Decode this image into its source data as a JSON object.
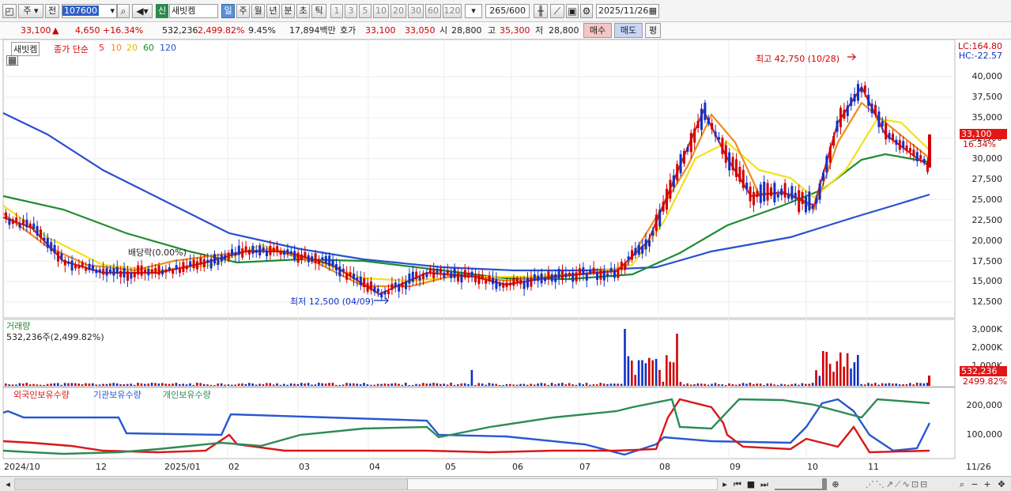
{
  "toolbar": {
    "period_unit": "주",
    "prev_label": "전",
    "code": "107600",
    "market_badge": "신",
    "stock_name": "새빗켐",
    "periods": [
      "일",
      "주",
      "월",
      "년",
      "분",
      "초",
      "틱"
    ],
    "selected_period": "일",
    "minutes": [
      "1",
      "3",
      "5",
      "10",
      "20",
      "30",
      "60",
      "120"
    ],
    "count_value": "265",
    "count_total": "/600",
    "date": "2025/11/26"
  },
  "quote": {
    "price": "33,100",
    "arrow": "▲",
    "change": "4,650",
    "change_pct": "+16.34%",
    "volume": "532,236",
    "volume_pct": "2,499.82%",
    "turnover": "9.45%",
    "amount": "17,894백만",
    "bid_label": "호가",
    "ask": "33,100",
    "bid": "33,050",
    "open_label": "시",
    "open": "28,800",
    "high_label": "고",
    "high": "35,300",
    "low_label": "저",
    "low": "28,800",
    "buy_label": "매수",
    "sell_label": "매도",
    "eval_label": "평"
  },
  "legend": {
    "name": "새빗켐",
    "close_label": "종가 단순",
    "ma": [
      {
        "label": "5",
        "color": "#e02020"
      },
      {
        "label": "10",
        "color": "#f08c1e"
      },
      {
        "label": "20",
        "color": "#f2e21e"
      },
      {
        "label": "60",
        "color": "#1e8c32"
      },
      {
        "label": "120",
        "color": "#2850d2"
      }
    ]
  },
  "annotations": {
    "high": "최고 42,750 (10/28)",
    "low": "최저 12,500 (04/09)",
    "dividend": "배당락(0.00%)"
  },
  "price_axis": {
    "lc": "LC:164.80",
    "hc": "HC:-22.57",
    "ticks": [
      "40,000",
      "37,500",
      "35,000",
      "32,500",
      "30,000",
      "27,500",
      "25,000",
      "22,500",
      "20,000",
      "17,500",
      "15,000",
      "12,500"
    ],
    "current": "33,100",
    "current_pct": "16.34%"
  },
  "volume_panel": {
    "title": "거래량",
    "value": "532,236주(2,499.82%)",
    "ticks": [
      "3,000K",
      "2,000K",
      "1,000K"
    ],
    "current": "532,236",
    "current_pct": "2499.82%"
  },
  "holdings_panel": {
    "series": [
      {
        "label": "외국인보유수량",
        "color": "#d81818"
      },
      {
        "label": "기관보유수량",
        "color": "#2858d0"
      },
      {
        "label": "개인보유수량",
        "color": "#2e8a58"
      }
    ],
    "ticks": [
      "200,000",
      "100,000"
    ]
  },
  "date_axis": [
    "2024/10",
    "12",
    "2025/01",
    "02",
    "03",
    "04",
    "05",
    "06",
    "07",
    "08",
    "09",
    "10",
    "11",
    "11/26"
  ],
  "colors": {
    "up": "#d10000",
    "down": "#1030c8",
    "ma5": "#e02020",
    "ma10": "#f08c1e",
    "ma20": "#f2e21e",
    "ma60": "#1e8c32",
    "ma120": "#2850d2"
  }
}
